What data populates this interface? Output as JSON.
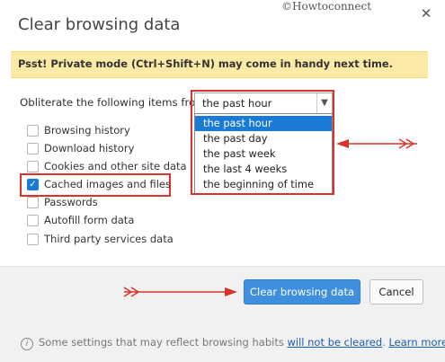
{
  "dialog": {
    "title": "Clear browsing data",
    "watermark": "©Howtoconnect",
    "close_glyph": "✕"
  },
  "banner": {
    "text": "Psst! Private mode (Ctrl+Shift+N) may come in handy next time."
  },
  "obliterate": {
    "label": "Obliterate the following items from:",
    "selected_value": "the past hour",
    "options": [
      "the past hour",
      "the past day",
      "the past week",
      "the last 4 weeks",
      "the beginning of time"
    ]
  },
  "items": [
    {
      "label": "Browsing history",
      "checked": false
    },
    {
      "label": "Download history",
      "checked": false
    },
    {
      "label": "Cookies and other site data",
      "checked": false
    },
    {
      "label": "Cached images and files",
      "checked": true
    },
    {
      "label": "Passwords",
      "checked": false
    },
    {
      "label": "Autofill form data",
      "checked": false
    },
    {
      "label": "Third party services data",
      "checked": false
    }
  ],
  "buttons": {
    "primary": "Clear browsing data",
    "cancel": "Cancel"
  },
  "footer": {
    "info_icon": "i",
    "text": "Some settings that may reflect browsing habits ",
    "link1": "will not be cleared",
    "sep": ". ",
    "link2": "Learn more"
  },
  "colors": {
    "accent": "#1a7bd6",
    "annotation_red": "#d9342b",
    "banner_bg": "#fbeaa6"
  }
}
